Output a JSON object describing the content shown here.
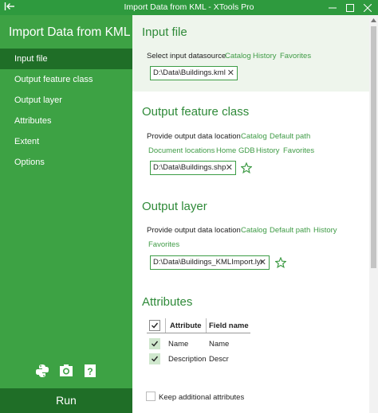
{
  "window": {
    "title": "Import Data from KML - XTools Pro"
  },
  "sidebar": {
    "app_title": "Import Data from KML",
    "items": [
      {
        "label": "Input file",
        "active": true
      },
      {
        "label": "Output feature class",
        "active": false
      },
      {
        "label": "Output layer",
        "active": false
      },
      {
        "label": "Attributes",
        "active": false
      },
      {
        "label": "Extent",
        "active": false
      },
      {
        "label": "Options",
        "active": false
      }
    ],
    "tool_icons": [
      "python-icon",
      "screenshot-icon",
      "help-icon"
    ],
    "run_label": "Run"
  },
  "input_file": {
    "title": "Input file",
    "prompt": "Select input datasource",
    "links": [
      "Catalog",
      "History",
      "Favorites"
    ],
    "path": "D:\\Data\\Buildings.kml"
  },
  "output_feature_class": {
    "title": "Output feature class",
    "prompt": "Provide output data location",
    "links": [
      "Catalog",
      "Default path",
      "Document locations",
      "Home GDB",
      "History",
      "Favorites"
    ],
    "path": "D:\\Data\\Buildings.shp"
  },
  "output_layer": {
    "title": "Output layer",
    "prompt": "Provide output data location",
    "links": [
      "Catalog",
      "Default path",
      "History",
      "Favorites"
    ],
    "path": "D:\\Data\\Buildings_KMLImport.lyr"
  },
  "attributes": {
    "title": "Attributes",
    "columns": [
      "Attribute",
      "Field name"
    ],
    "rows": [
      {
        "attribute": "Name",
        "field": "Name",
        "checked": true
      },
      {
        "attribute": "Description",
        "field": "Descr",
        "checked": true
      }
    ],
    "keep_additional_label": "Keep additional attributes",
    "keep_additional_checked": false
  },
  "colors": {
    "sidebar": "#3da244",
    "sidebar_active": "#1f6e27",
    "titlebar": "#2e9a3e",
    "accent": "#2f8a39",
    "link": "#3f9b46"
  }
}
